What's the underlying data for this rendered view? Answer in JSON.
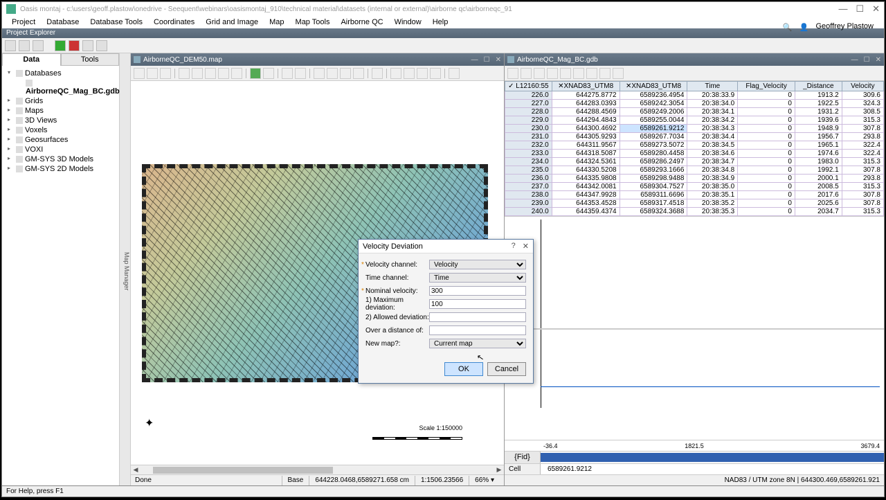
{
  "title": "Oasis montaj - c:\\users\\geoff.plastow\\onedrive - Seequent\\webinars\\oasismontaj_910\\technical material\\datasets (internal or external)\\airborne qc\\airborneqc_91",
  "user": "Geoffrey Plastow",
  "menu": [
    "Project",
    "Database",
    "Database Tools",
    "Coordinates",
    "Grid and Image",
    "Map",
    "Map Tools",
    "Airborne QC",
    "Window",
    "Help"
  ],
  "project_bar": "Project Explorer",
  "side_tabs": {
    "data": "Data",
    "tools": "Tools"
  },
  "tree": {
    "root": "Databases",
    "db": "AirborneQC_Mag_BC.gdb",
    "items": [
      "Grids",
      "Maps",
      "3D Views",
      "Voxels",
      "Geosurfaces",
      "VOXI",
      "GM-SYS 3D Models",
      "GM-SYS 2D Models"
    ]
  },
  "vtab": "Map Manager",
  "map_doc": "AirborneQC_DEM50.map",
  "db_doc": "AirborneQC_Mag_BC.gdb",
  "scale": "Scale 1:150000",
  "columns": [
    "L12160:55",
    "XNAD83_UTM8",
    "XNAD83_UTM8",
    "Time",
    "Flag_Velocity",
    "_Distance",
    "Velocity"
  ],
  "rows": [
    [
      "226.0",
      "644275.8772",
      "6589236.4954",
      "20:38:33.9",
      "0",
      "1913.2",
      "309.6"
    ],
    [
      "227.0",
      "644283.0393",
      "6589242.3054",
      "20:38:34.0",
      "0",
      "1922.5",
      "324.3"
    ],
    [
      "228.0",
      "644288.4569",
      "6589249.2006",
      "20:38:34.1",
      "0",
      "1931.2",
      "308.5"
    ],
    [
      "229.0",
      "644294.4843",
      "6589255.0044",
      "20:38:34.2",
      "0",
      "1939.6",
      "315.3"
    ],
    [
      "230.0",
      "644300.4692",
      "6589261.9212",
      "20:38:34.3",
      "0",
      "1948.9",
      "307.8"
    ],
    [
      "231.0",
      "644305.9293",
      "6589267.7034",
      "20:38:34.4",
      "0",
      "1956.7",
      "293.8"
    ],
    [
      "232.0",
      "644311.9567",
      "6589273.5072",
      "20:38:34.5",
      "0",
      "1965.1",
      "322.4"
    ],
    [
      "233.0",
      "644318.5087",
      "6589280.4458",
      "20:38:34.6",
      "0",
      "1974.6",
      "322.4"
    ],
    [
      "234.0",
      "644324.5361",
      "6589286.2497",
      "20:38:34.7",
      "0",
      "1983.0",
      "315.3"
    ],
    [
      "235.0",
      "644330.5208",
      "6589293.1666",
      "20:38:34.8",
      "0",
      "1992.1",
      "307.8"
    ],
    [
      "236.0",
      "644335.9808",
      "6589298.9488",
      "20:38:34.9",
      "0",
      "2000.1",
      "293.8"
    ],
    [
      "237.0",
      "644342.0081",
      "6589304.7527",
      "20:38:35.0",
      "0",
      "2008.5",
      "315.3"
    ],
    [
      "238.0",
      "644347.9928",
      "6589311.6696",
      "20:38:35.1",
      "0",
      "2017.6",
      "307.8"
    ],
    [
      "239.0",
      "644353.4528",
      "6589317.4518",
      "20:38:35.2",
      "0",
      "2025.6",
      "307.8"
    ],
    [
      "240.0",
      "644359.4374",
      "6589324.3688",
      "20:38:35.3",
      "0",
      "2034.7",
      "315.3"
    ]
  ],
  "hl_row": 4,
  "axis": {
    "min": "-36.4",
    "mid": "1821.5",
    "max": "3679.4"
  },
  "fid_label": "{Fid}",
  "cell_label": "Cell",
  "cell_value": "6589261.9212",
  "status": {
    "done": "Done",
    "base": "Base",
    "coord": "644228.0468,6589271.658 cm",
    "scale": "1:1506.23566",
    "zoom": "66%"
  },
  "status2": {
    "right": "NAD83 / UTM zone 8N   |   644300.469,6589261.921   "
  },
  "footer": "For Help, press F1",
  "dialog": {
    "title": "Velocity Deviation",
    "labels": {
      "vc": "Velocity channel:",
      "tc": "Time channel:",
      "nv": "Nominal velocity:",
      "md": "1) Maximum deviation:",
      "ad": "2) Allowed deviation:",
      "od": "Over a distance of:",
      "nm": "New map?:"
    },
    "values": {
      "vc": "Velocity",
      "tc": "Time",
      "nv": "300",
      "md": "100",
      "ad": "",
      "od": "",
      "nm": "Current map"
    },
    "ok": "OK",
    "cancel": "Cancel"
  }
}
